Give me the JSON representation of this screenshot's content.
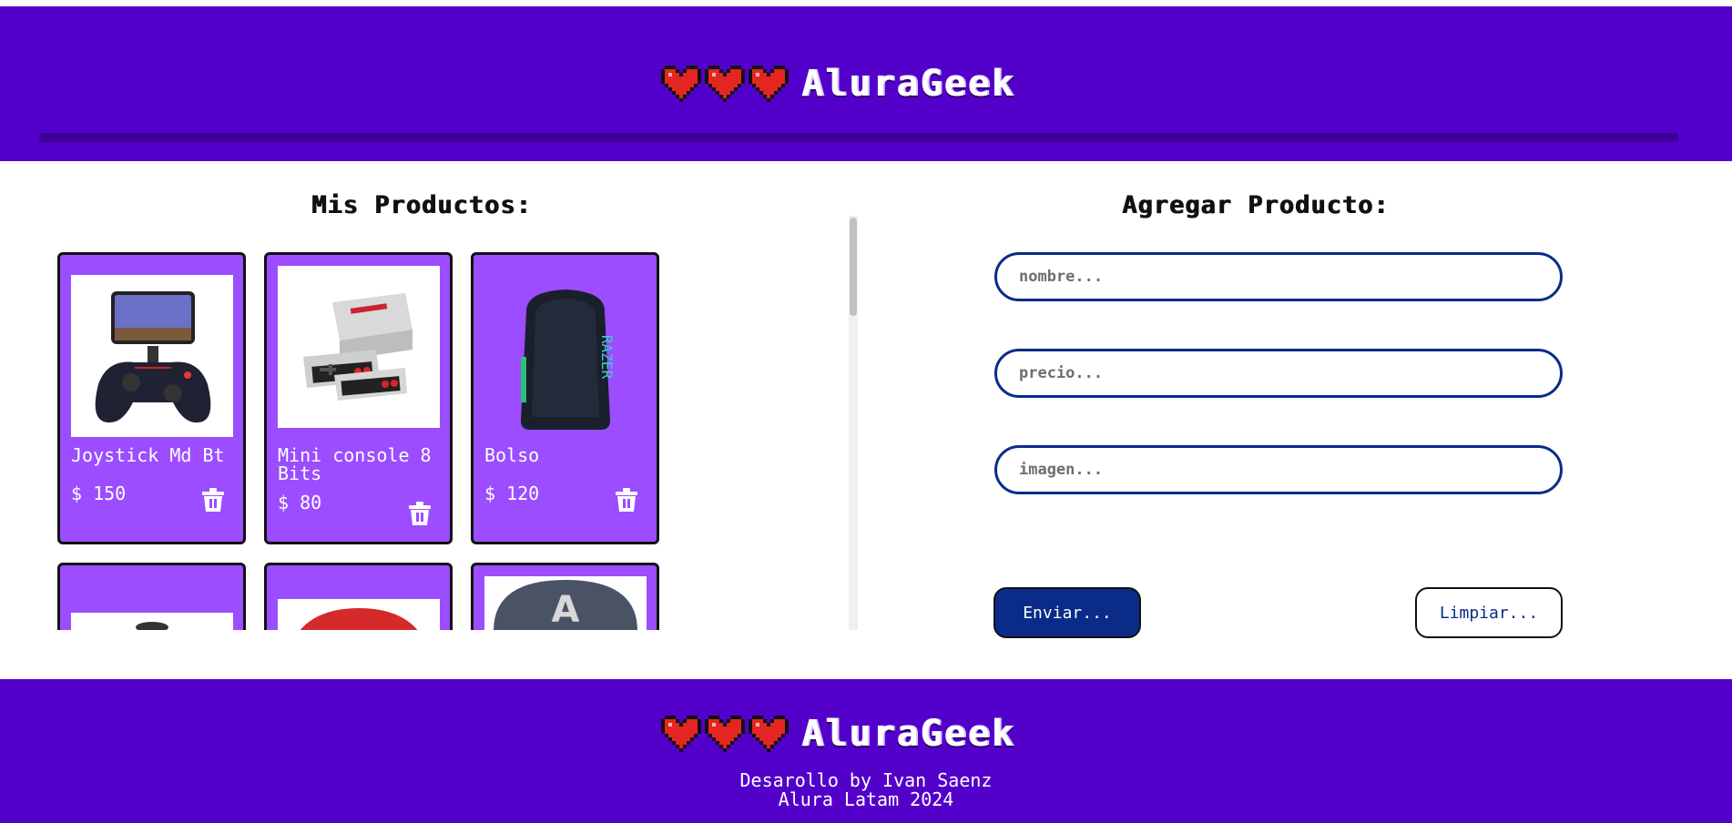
{
  "header": {
    "brand": "AluraGeek"
  },
  "products_section": {
    "title": "Mis Productos:",
    "products": [
      {
        "name": "Joystick Md Bt",
        "price": "$ 150"
      },
      {
        "name": "Mini console 8 Bits",
        "price": "$ 80"
      },
      {
        "name": "Bolso",
        "price": "$ 120"
      },
      {
        "name": "",
        "price": ""
      },
      {
        "name": "",
        "price": ""
      },
      {
        "name": "",
        "price": ""
      }
    ]
  },
  "form": {
    "title": "Agregar Producto:",
    "name_placeholder": "nombre...",
    "price_placeholder": "precio...",
    "image_placeholder": "imagen...",
    "send_label": "Enviar...",
    "clear_label": "Limpiar..."
  },
  "footer": {
    "brand": "AluraGeek",
    "credit_line1": "Desarollo by Ivan Saenz",
    "credit_line2": "Alura Latam 2024"
  },
  "colors": {
    "header_bg": "#5400cb",
    "card_bg": "#9b4dff",
    "accent_blue": "#0a2c88"
  },
  "icons": [
    "heart-icon",
    "trash-icon"
  ]
}
